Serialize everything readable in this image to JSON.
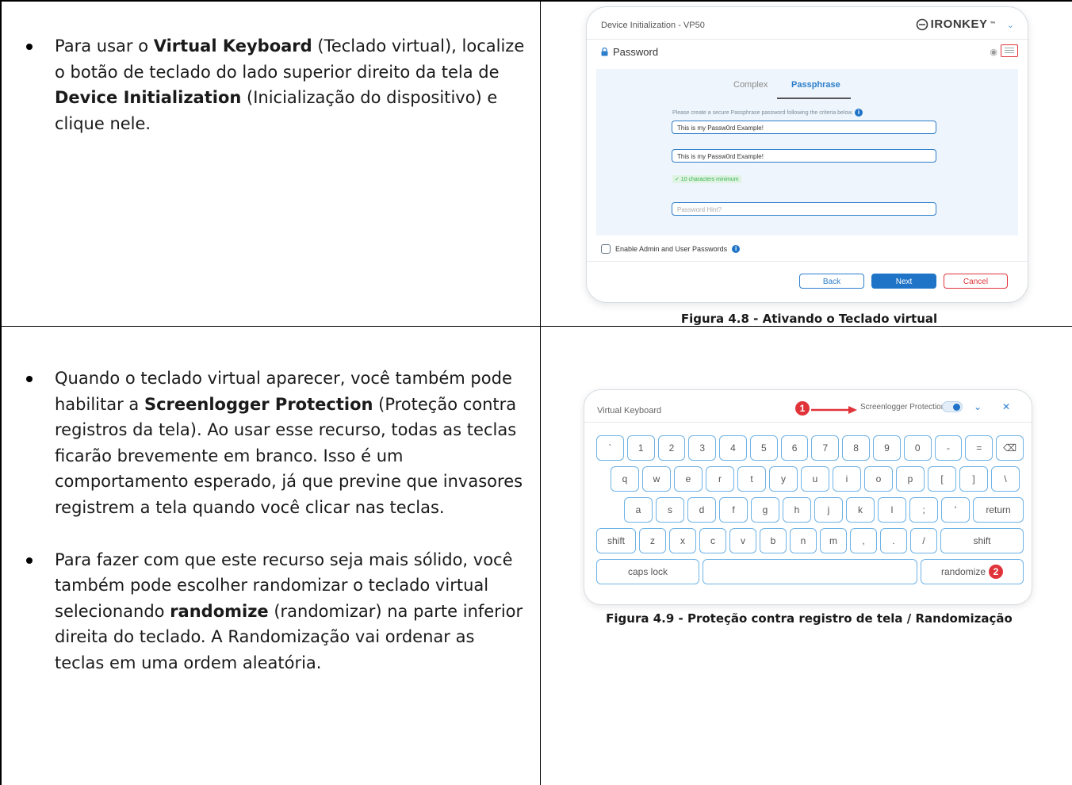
{
  "row1": {
    "bullets": [
      {
        "segments": [
          {
            "t": "Para usar o ",
            "b": false
          },
          {
            "t": "Virtual Keyboard",
            "b": true
          },
          {
            "t": " (Teclado virtual), localize o botão de teclado do lado superior direito da tela de ",
            "b": false
          },
          {
            "t": "Device Initialization",
            "b": true
          },
          {
            "t": " (Inicialização do dispositivo) e clique nele.",
            "b": false
          }
        ]
      }
    ],
    "caption": "Figura 4.8 - Ativando o Teclado virtual"
  },
  "row2": {
    "bullets": [
      {
        "segments": [
          {
            "t": "Quando o teclado virtual aparecer, você também pode habilitar a ",
            "b": false
          },
          {
            "t": "Screenlogger Protection",
            "b": true
          },
          {
            "t": " (Proteção contra registros da tela). Ao usar esse recurso, todas as teclas ficarão brevemente em branco. Isso é um comportamento esperado, já que previne que invasores registrem a tela quando você clicar nas teclas.",
            "b": false
          }
        ]
      },
      {
        "segments": [
          {
            "t": "Para fazer com que este recurso seja mais sólido, você também pode escolher randomizar o teclado virtual selecionando ",
            "b": false
          },
          {
            "t": "randomize",
            "b": true
          },
          {
            "t": " (randomizar) na parte inferior direita do teclado. A Randomização vai ordenar as teclas em uma ordem aleatória.",
            "b": false
          }
        ]
      }
    ],
    "caption": "Figura 4.9 - Proteção contra registro de tela / Randomização"
  },
  "fig48": {
    "title": "Device Initialization - VP50",
    "brand": "IRONKEY",
    "brand_mark": "™",
    "section": "Password",
    "tabs": [
      "Complex",
      "Passphrase"
    ],
    "helper": "Please create a secure Passphrase password following the criteria below.",
    "password": "This is my Passw0rd Example!",
    "confirm": "This is my Passw0rd Example!",
    "criteria": "✓ 10 characters minimum",
    "hint_placeholder": "Password Hint?",
    "admin_checkbox": "Enable Admin and User Passwords",
    "buttons": {
      "back": "Back",
      "next": "Next",
      "cancel": "Cancel"
    }
  },
  "fig49": {
    "title": "Virtual Keyboard",
    "protection": "Screenlogger Protection",
    "marker1": "1",
    "marker2": "2",
    "rows": [
      [
        "`",
        "1",
        "2",
        "3",
        "4",
        "5",
        "6",
        "7",
        "8",
        "9",
        "0",
        "-",
        "=",
        "⌫"
      ],
      [
        "q",
        "w",
        "e",
        "r",
        "t",
        "y",
        "u",
        "i",
        "o",
        "p",
        "[",
        "]",
        "\\"
      ],
      [
        "a",
        "s",
        "d",
        "f",
        "g",
        "h",
        "j",
        "k",
        "l",
        ";",
        "'",
        "return"
      ],
      [
        "shift",
        "z",
        "x",
        "c",
        "v",
        "b",
        "n",
        "m",
        ",",
        ".",
        "/",
        "shift"
      ],
      [
        "caps lock",
        " ",
        "randomize"
      ]
    ]
  },
  "colors": {
    "accent": "#1f74c8",
    "marker": "#e0343a",
    "key_border": "#6fb3e6"
  }
}
